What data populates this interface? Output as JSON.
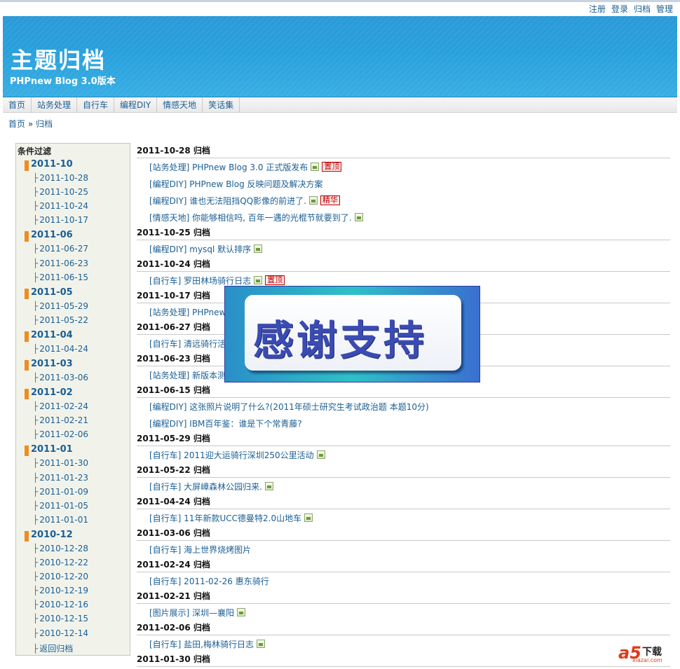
{
  "top_links": [
    "注册",
    "登录",
    "归档",
    "管理"
  ],
  "header": {
    "title": "主题归档",
    "subtitle": "PHPnew Blog 3.0版本"
  },
  "nav": [
    "首页",
    "站务处理",
    "自行车",
    "编程DIY",
    "情感天地",
    "笑话集"
  ],
  "breadcrumb": {
    "home": "首页",
    "sep": "»",
    "current": "归档"
  },
  "sidebar": {
    "title": "条件过滤",
    "months": [
      {
        "label": "2011-10",
        "days": [
          "2011-10-28",
          "2011-10-25",
          "2011-10-24",
          "2011-10-17"
        ]
      },
      {
        "label": "2011-06",
        "days": [
          "2011-06-27",
          "2011-06-23",
          "2011-06-15"
        ]
      },
      {
        "label": "2011-05",
        "days": [
          "2011-05-29",
          "2011-05-22"
        ]
      },
      {
        "label": "2011-04",
        "days": [
          "2011-04-24"
        ]
      },
      {
        "label": "2011-03",
        "days": [
          "2011-03-06"
        ]
      },
      {
        "label": "2011-02",
        "days": [
          "2011-02-24",
          "2011-02-21",
          "2011-02-06"
        ]
      },
      {
        "label": "2011-01",
        "days": [
          "2011-01-30",
          "2011-01-23",
          "2011-01-09",
          "2011-01-05",
          "2011-01-01"
        ]
      },
      {
        "label": "2010-12",
        "days": [
          "2010-12-28",
          "2010-12-22",
          "2010-12-20",
          "2010-12-19",
          "2010-12-16",
          "2010-12-15",
          "2010-12-14"
        ]
      }
    ],
    "back": "返回归档"
  },
  "archive": [
    {
      "date": "2011-10-28 归档",
      "posts": [
        {
          "text": "[站务处理] PHPnew Blog 3.0 正式版发布",
          "icon": "image-icon",
          "tag": "置顶"
        },
        {
          "text": "[编程DIY] PHPnew Blog 反映问题及解决方案"
        },
        {
          "text": "[编程DIY] 谁也无法阻挡QQ影像的前进了.",
          "icon": "image-icon",
          "tag": "精华"
        },
        {
          "text": "[情感天地] 你能够相信吗, 百年一遇的光棍节就要到了.",
          "icon": "image-icon"
        }
      ]
    },
    {
      "date": "2011-10-25 归档",
      "posts": [
        {
          "text": "[编程DIY] mysql 默认排序",
          "icon": "image-icon"
        }
      ]
    },
    {
      "date": "2011-10-24 归档",
      "posts": [
        {
          "text": "[自行车] 罗田林场骑行日志",
          "icon": "image-icon",
          "tag": "置顶"
        }
      ]
    },
    {
      "date": "2011-10-17 归档",
      "posts": [
        {
          "text": "[站务处理] PHPnew"
        }
      ]
    },
    {
      "date": "2011-06-27 归档",
      "posts": [
        {
          "text": "[自行车] 清远骑行活动"
        }
      ]
    },
    {
      "date": "2011-06-23 归档",
      "posts": [
        {
          "text": "[站务处理] 新版本测"
        }
      ]
    },
    {
      "date": "2011-06-15 归档",
      "posts": [
        {
          "text": "[编程DIY] 这张照片说明了什么?(2011年硕士研究生考试政治题 本题10分)"
        },
        {
          "text": "[编程DIY] IBM百年鉴：谁是下个常青藤?"
        }
      ]
    },
    {
      "date": "2011-05-29 归档",
      "posts": [
        {
          "text": "[自行车] 2011迎大运骑行深圳250公里活动",
          "icon": "image-icon"
        }
      ]
    },
    {
      "date": "2011-05-22 归档",
      "posts": [
        {
          "text": "[自行车] 大屏嶂森林公园归来.",
          "icon": "image-icon"
        }
      ]
    },
    {
      "date": "2011-04-24 归档",
      "posts": [
        {
          "text": "[自行车] 11年新款UCC德曼特2.0山地车",
          "icon": "image-icon"
        }
      ]
    },
    {
      "date": "2011-03-06 归档",
      "posts": [
        {
          "text": "[自行车] 海上世界烧烤图片"
        }
      ]
    },
    {
      "date": "2011-02-24 归档",
      "posts": [
        {
          "text": "[自行车] 2011-02-26 惠东骑行"
        }
      ]
    },
    {
      "date": "2011-02-21 归档",
      "posts": [
        {
          "text": "[图片展示] 深圳—襄阳",
          "icon": "image-icon"
        }
      ]
    },
    {
      "date": "2011-02-06 归档",
      "posts": [
        {
          "text": "[自行车] 盐田,梅林骑行日志",
          "icon": "image-icon"
        }
      ]
    },
    {
      "date": "2011-01-30 归档",
      "posts": []
    }
  ],
  "overlay": {
    "text": "感谢支持"
  },
  "watermark": {
    "brand": "a5",
    "label": "下载",
    "url": "xiazai.com"
  }
}
